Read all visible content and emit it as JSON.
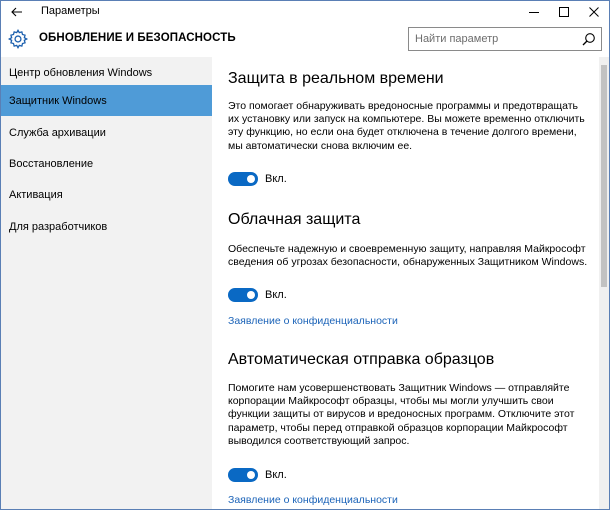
{
  "window": {
    "title": "Параметры",
    "accent": "#4f9bd7"
  },
  "header": {
    "section_title": "ОБНОВЛЕНИЕ И БЕЗОПАСНОСТЬ",
    "icon": "gear-icon",
    "search_placeholder": "Найти параметр"
  },
  "sidebar": {
    "items": [
      {
        "label": "Центр обновления Windows",
        "active": false
      },
      {
        "label": "Защитник Windows",
        "active": true
      },
      {
        "label": "Служба архивации",
        "active": false
      },
      {
        "label": "Восстановление",
        "active": false
      },
      {
        "label": "Активация",
        "active": false
      },
      {
        "label": "Для разработчиков",
        "active": false
      }
    ]
  },
  "content": {
    "realtime": {
      "title": "Защита в реальном времени",
      "description": "Это помогает обнаруживать вредоносные программы и предотвращать их установку или запуск на компьютере. Вы можете временно отключить эту функцию, но если она будет отключена в течение долгого времени, мы автоматически снова включим ее.",
      "toggle_label": "Вкл.",
      "toggle_on": true
    },
    "cloud": {
      "title": "Облачная защита",
      "description": "Обеспечьте надежную и своевременную защиту, направляя Майкрософт сведения об угрозах безопасности, обнаруженных Защитником Windows.",
      "toggle_label": "Вкл.",
      "toggle_on": true,
      "privacy_link": "Заявление о конфиденциальности"
    },
    "samples": {
      "title": "Автоматическая отправка образцов",
      "description": "Помогите нам усовершенствовать Защитник Windows — отправляйте корпорации Майкрософт образцы, чтобы мы могли улучшить свои функции защиты от вирусов и вредоносных программ. Отключите этот параметр, чтобы перед отправкой образцов корпорации Майкрософт выводился соответствующий запрос.",
      "toggle_label": "Вкл.",
      "toggle_on": true,
      "privacy_link": "Заявление о конфиденциальности"
    }
  }
}
